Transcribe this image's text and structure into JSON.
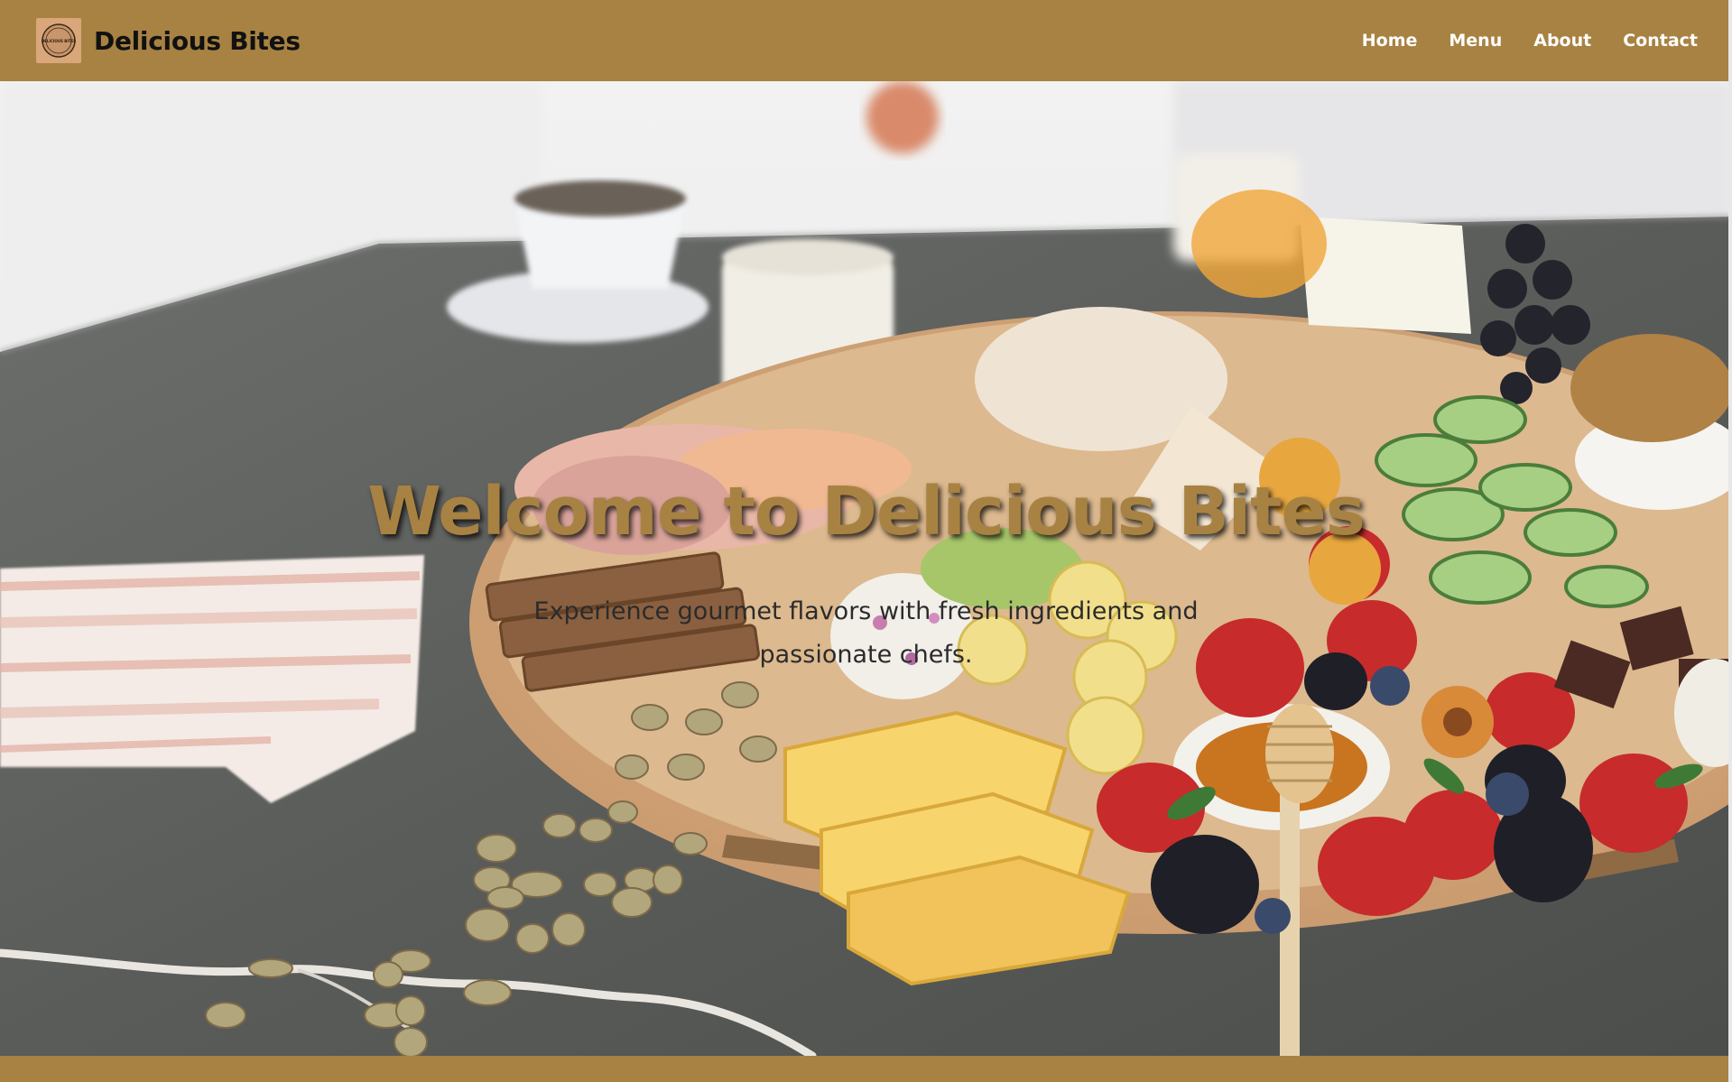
{
  "header": {
    "brand_name": "Delicious Bites",
    "logo_text": "DELICIOUS BITES",
    "nav": [
      {
        "label": "Home"
      },
      {
        "label": "Menu"
      },
      {
        "label": "About"
      },
      {
        "label": "Contact"
      }
    ]
  },
  "hero": {
    "title": "Welcome to Delicious Bites",
    "subtitle": "Experience gourmet flavors with fresh ingredients and passionate chefs."
  },
  "colors": {
    "brand": "#a88242",
    "nav_text": "#ffffff",
    "brand_text": "#111111"
  }
}
